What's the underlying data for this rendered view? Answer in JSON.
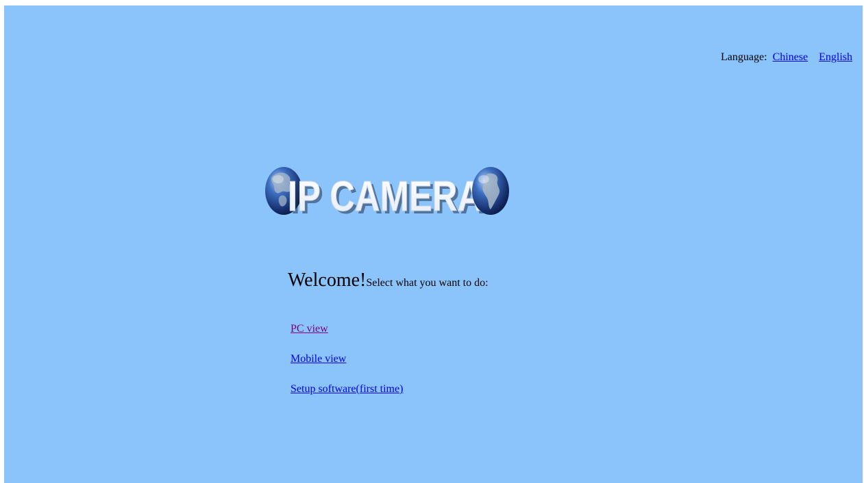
{
  "language": {
    "label": "Language:",
    "options": [
      "Chinese",
      "English"
    ]
  },
  "logo": {
    "text": "IP CAMERA",
    "icons": [
      "globe-icon-north-america",
      "globe-icon-south-america"
    ],
    "colors": {
      "text": "#ffffff",
      "globe": "#1d3f8c"
    }
  },
  "welcome": {
    "greeting": "Welcome!",
    "prompt": "Select what you want to do:"
  },
  "actions": {
    "pc_view": "PC view",
    "mobile_view": "Mobile view",
    "setup": "Setup software(first time)"
  },
  "colors": {
    "background": "#8ac4fb",
    "link": "#0000ee",
    "visited_link": "#800080"
  }
}
